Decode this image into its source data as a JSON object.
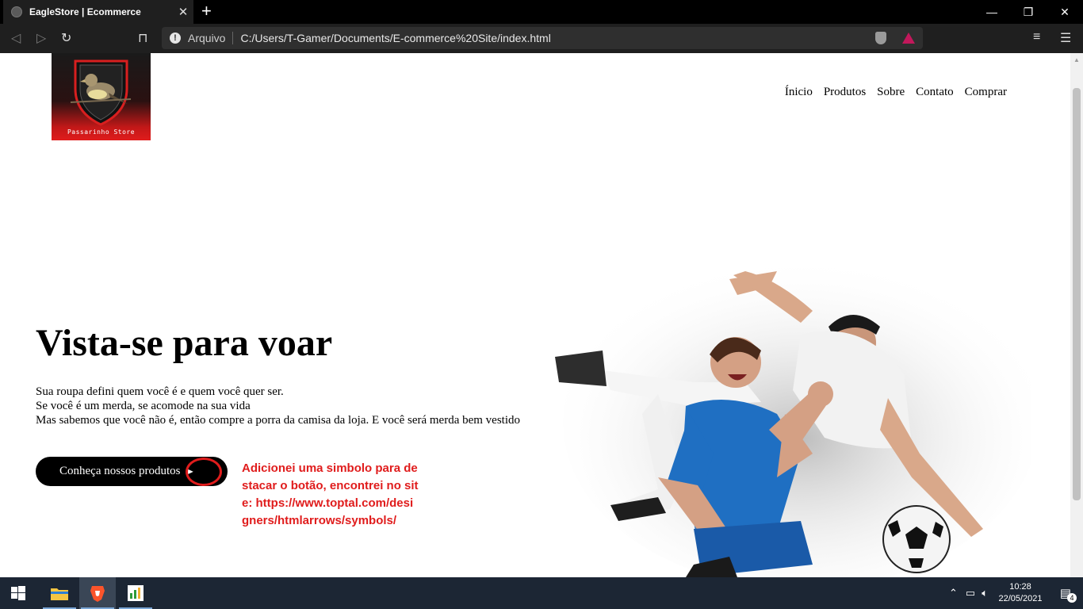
{
  "browser": {
    "tab_title": "EagleStore | Ecommerce",
    "tab_close": "✕",
    "new_tab": "+",
    "window_controls": {
      "minimize": "—",
      "maximize": "❐",
      "close": "✕"
    },
    "address_scheme": "Arquivo",
    "address_url": "C:/Users/T-Gamer/Documents/E-commerce%20Site/index.html"
  },
  "site": {
    "logo_text": "Passarinho Store",
    "nav": [
      "Ínicio",
      "Produtos",
      "Sobre",
      "Contato",
      "Comprar"
    ],
    "hero": {
      "title": "Vista-se para voar",
      "lines": [
        "Sua roupa defini quem você é e quem você quer ser.",
        "Se você é um merda, se acomode na sua vida",
        "Mas sabemos que você não é, então compre a porra da camisa da loja. E você será merda bem vestido"
      ],
      "cta_label": "Conheça nossos produtos",
      "cta_arrow": "➤"
    },
    "annotation": "Adicionei uma simbolo para destacar o botão, encontrei no site: https://www.toptal.com/designers/htmlarrows/symbols/"
  },
  "taskbar": {
    "time": "10:28",
    "date": "22/05/2021",
    "notification_count": "4"
  },
  "colors": {
    "annotation": "#e01c1c",
    "cta_bg": "#000000",
    "jersey_blue": "#1f6fc2"
  }
}
